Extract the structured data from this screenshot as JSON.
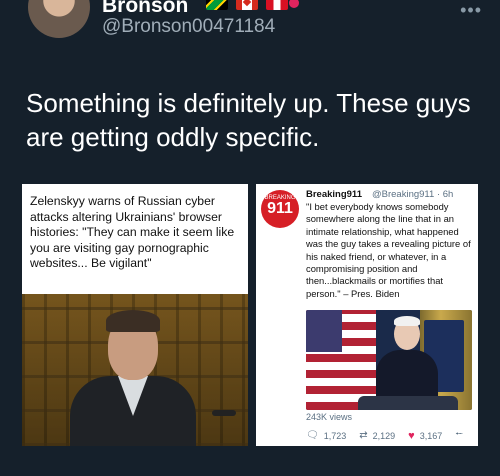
{
  "tweet": {
    "display_name": "Bronson",
    "handle": "@Bronson00471184",
    "text": "Something is definitely up.  These guys are getting oddly specific."
  },
  "left_card": {
    "text": "Zelenskyy warns of Russian cyber attacks altering Ukrainians' browser histories: \"They can make it seem like you are visiting gay pornographic websites... Be vigilant\""
  },
  "right_card": {
    "logo_small": "BREAKING",
    "logo_main": "911",
    "name": "Breaking911",
    "handle_time": "@Breaking911 · 6h",
    "text": "\"I bet everybody knows somebody somewhere along the line that in an intimate relationship, what happened was the guy takes a revealing picture of his naked friend, or whatever, in a compromising position and then...blackmails or mortifies that person.\" – Pres. Biden",
    "views": "243K views",
    "replies": "1,723",
    "retweets": "2,129",
    "likes": "3,167"
  },
  "icons": [
    "more-icon",
    "flag-jamaica-icon",
    "flag-canada-icon",
    "flag-peru-icon",
    "drop-icon",
    "reply-icon",
    "retweet-icon",
    "heart-icon",
    "share-icon"
  ],
  "colors": {
    "background": "#15202b",
    "handle": "#a0adb8",
    "breaking_red": "#d61f26",
    "like": "#e0245e"
  }
}
